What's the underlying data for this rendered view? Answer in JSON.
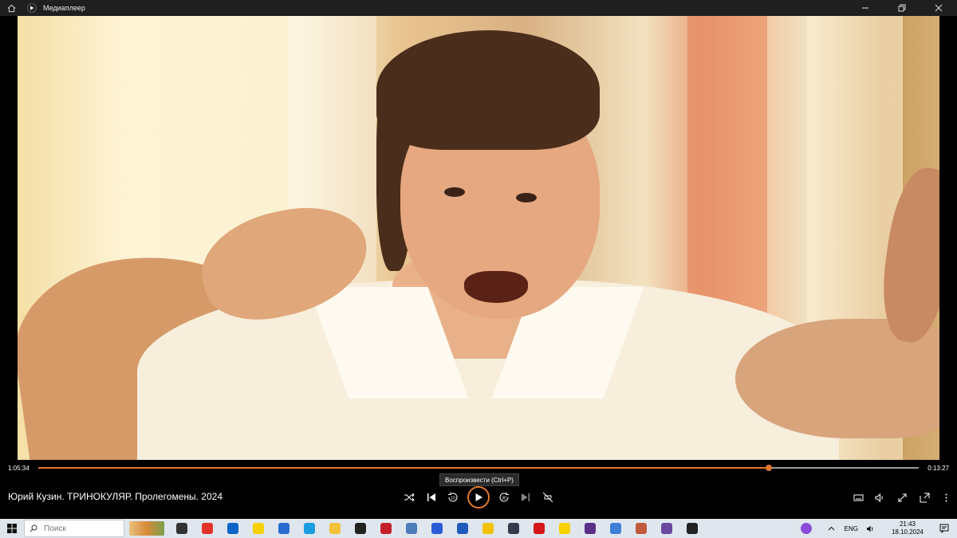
{
  "window": {
    "title": "Медиаплеер"
  },
  "player": {
    "media_title": "Юрий Кузин. ТРИНОКУЛЯР. Пролегомены. 2024",
    "elapsed": "1:05:34",
    "remaining": "0:13:27",
    "progress": 0.83,
    "play_tooltip": "Воспроизвести (Ctrl+P)",
    "skip_back": "10",
    "skip_forward": "30"
  },
  "taskbar": {
    "search_label": "Поиск",
    "apps": [
      {
        "name": "task-view",
        "color": "#333333"
      },
      {
        "name": "yandex",
        "color": "#e4322b"
      },
      {
        "name": "outlook",
        "color": "#0a64c8"
      },
      {
        "name": "yandex-browser",
        "color": "#f5d000"
      },
      {
        "name": "app-blue",
        "color": "#2a6bd0"
      },
      {
        "name": "edge",
        "color": "#1b9de2"
      },
      {
        "name": "explorer",
        "color": "#f4c23a"
      },
      {
        "name": "app-dark",
        "color": "#222222"
      },
      {
        "name": "app-red",
        "color": "#c5202a"
      },
      {
        "name": "app-globe",
        "color": "#4d7cba"
      },
      {
        "name": "app-a",
        "color": "#2c5bd6"
      },
      {
        "name": "word",
        "color": "#1f5bbd"
      },
      {
        "name": "app-yellow",
        "color": "#f2c300"
      },
      {
        "name": "audio-app",
        "color": "#333a4a"
      },
      {
        "name": "opera",
        "color": "#d5161b"
      },
      {
        "name": "app-y",
        "color": "#f7d000"
      },
      {
        "name": "app-star",
        "color": "#5a2f86"
      },
      {
        "name": "store",
        "color": "#3e7fd8"
      },
      {
        "name": "app-pic",
        "color": "#c05a3a"
      },
      {
        "name": "app-game",
        "color": "#6a4aa0"
      },
      {
        "name": "media-player",
        "color": "#222222"
      }
    ],
    "language": "ENG",
    "time": "21:43",
    "date": "18.10.2024"
  },
  "colors": {
    "accent": "#e0772f",
    "titlebar": "#1f1f1f",
    "taskbar": "#dfe6ee"
  }
}
